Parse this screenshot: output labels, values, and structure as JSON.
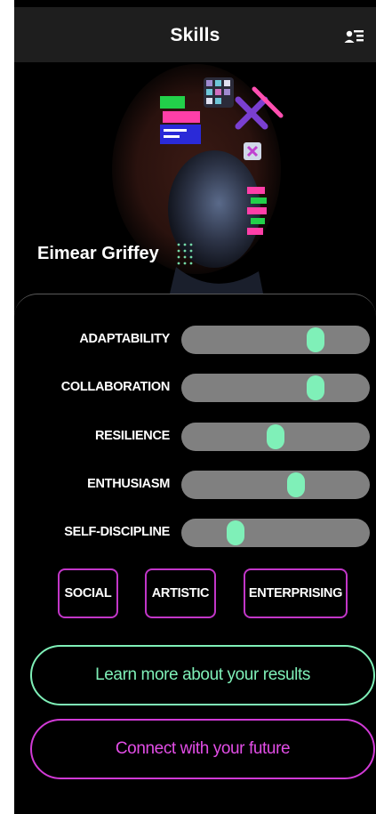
{
  "header": {
    "title": "Skills",
    "profile_icon": "user-list-icon"
  },
  "hero": {
    "name": "Eimear Griffey"
  },
  "skills": [
    {
      "label": "ADAPTABILITY",
      "level": 0.71
    },
    {
      "label": "COLLABORATION",
      "level": 0.71
    },
    {
      "label": "RESILIENCE",
      "level": 0.5
    },
    {
      "label": "ENTHUSIASM",
      "level": 0.61
    },
    {
      "label": "SELF-DISCIPLINE",
      "level": 0.29
    }
  ],
  "interests": [
    "SOCIAL",
    "ARTISTIC",
    "ENTERPRISING"
  ],
  "actions": {
    "learn_more": "Learn more about your results",
    "connect": "Connect with your future"
  },
  "colors": {
    "accent_green": "#7ff0b8",
    "accent_purple": "#c236c8",
    "track": "#808080"
  }
}
